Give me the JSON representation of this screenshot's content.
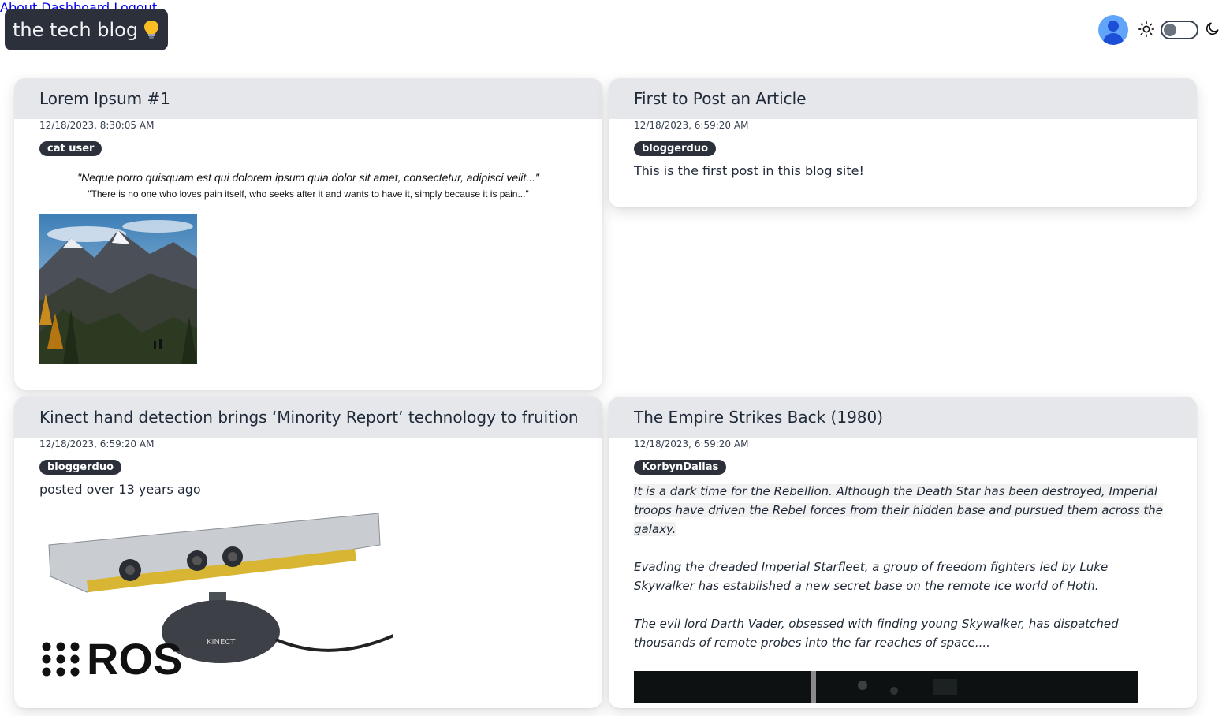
{
  "header": {
    "brand_label": "the tech blog",
    "nav": {
      "about": "About",
      "dashboard": "Dashboard",
      "logout": "Logout"
    }
  },
  "posts": [
    {
      "title": "Lorem Ipsum #1",
      "date": "12/18/2023, 8:30:05 AM",
      "author": "cat user",
      "quote": "\"Neque porro quisquam est qui dolorem ipsum quia dolor sit amet, consectetur, adipisci velit...\"",
      "quote_translation": "\"There is no one who loves pain itself, who seeks after it and wants to have it, simply because it is pain...\"",
      "image": "mountain-landscape"
    },
    {
      "title": "First to Post an Article",
      "date": "12/18/2023, 6:59:20 AM",
      "author": "bloggerduo",
      "body": "This is the first post in this blog site!"
    },
    {
      "title": "Kinect hand detection brings ‘Minority Report’ technology to fruition",
      "date": "12/18/2023, 6:59:20 AM",
      "author": "bloggerduo",
      "body": "posted over 13 years ago",
      "image": "kinect-ros",
      "image_text": "ROS",
      "image_device_label": "KINECT"
    },
    {
      "title": "The Empire Strikes Back (1980)",
      "date": "12/18/2023, 6:59:20 AM",
      "author": "KorbynDallas",
      "paragraphs": [
        "It is a dark time for the Rebellion. Although the Death Star has been destroyed, Imperial troops have driven the Rebel forces from their hidden base and pursued them across the galaxy.",
        "Evading the dreaded Imperial Starfleet, a group of freedom fighters led by Luke Skywalker has established a new secret base on the remote ice world of Hoth.",
        "The evil lord Darth Vader, obsessed with finding young Skywalker, has dispatched thousands of remote probes into the far reaches of space...."
      ],
      "image": "movie-still"
    }
  ]
}
